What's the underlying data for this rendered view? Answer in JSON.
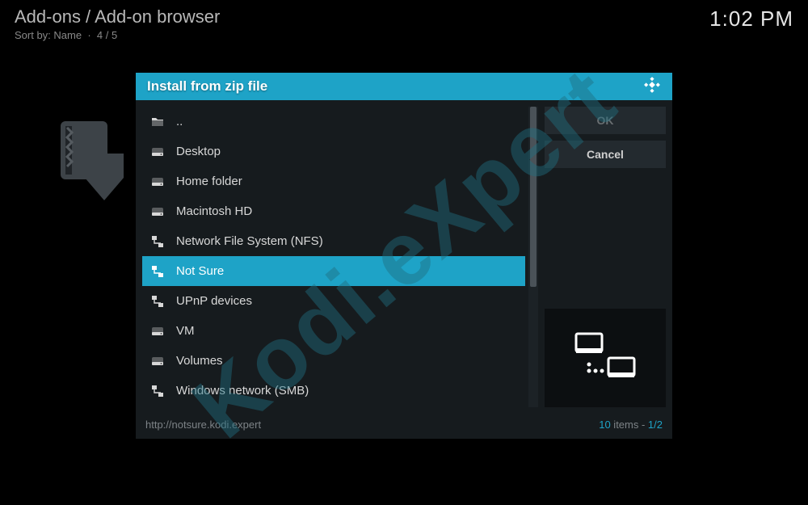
{
  "header": {
    "breadcrumb": "Add-ons / Add-on browser",
    "sort_label": "Sort by:",
    "sort_value": "Name",
    "page_pos": "4 / 5",
    "clock": "1:02 PM"
  },
  "dialog": {
    "title": "Install from zip file",
    "items": [
      {
        "icon": "folder-up-icon",
        "label": ".."
      },
      {
        "icon": "drive-icon",
        "label": "Desktop"
      },
      {
        "icon": "drive-icon",
        "label": "Home folder"
      },
      {
        "icon": "drive-icon",
        "label": "Macintosh HD"
      },
      {
        "icon": "network-icon",
        "label": "Network File System (NFS)"
      },
      {
        "icon": "network-icon",
        "label": "Not Sure",
        "selected": true
      },
      {
        "icon": "network-icon",
        "label": "UPnP devices"
      },
      {
        "icon": "drive-icon",
        "label": "VM"
      },
      {
        "icon": "drive-icon",
        "label": "Volumes"
      },
      {
        "icon": "network-icon",
        "label": "Windows network (SMB)"
      }
    ],
    "buttons": {
      "ok": "OK",
      "cancel": "Cancel"
    },
    "footer": {
      "path": "http://notsure.kodi.expert",
      "count": "10",
      "count_suffix": " items - ",
      "page": "1/2"
    }
  },
  "watermark": "Kodi.eXpert"
}
